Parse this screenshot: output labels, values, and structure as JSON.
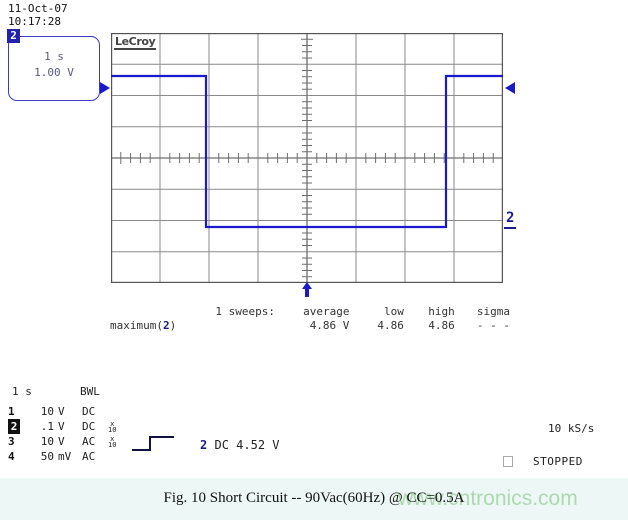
{
  "header": {
    "date": "11-Oct-07",
    "time": "10:17:28"
  },
  "channel_box": {
    "badge": "2",
    "timebase": "1 s",
    "volts_div": "1.00 V"
  },
  "scope": {
    "brand": "LeCroy",
    "ground_marker_label": "2",
    "grid_divisions_x": 8,
    "grid_divisions_y": 8
  },
  "measurements": {
    "headers": [
      "",
      "1 sweeps:",
      "average",
      "low",
      "high",
      "sigma"
    ],
    "rows": [
      {
        "name": "maximum(",
        "channel": "2",
        "name_end": ")",
        "average": "4.86 V",
        "low": "4.86",
        "high": "4.86",
        "sigma": "- - -"
      }
    ]
  },
  "settings": {
    "timebase": "1 s",
    "bandwidth_limit": "BWL",
    "channels": [
      {
        "num": "1",
        "value": "10",
        "unit": "V",
        "coupling": "DC",
        "atten": "",
        "selected": false
      },
      {
        "num": "2",
        "value": ".1",
        "unit": "V",
        "coupling": "DC",
        "atten": "x10",
        "selected": true
      },
      {
        "num": "3",
        "value": "10",
        "unit": "V",
        "coupling": "AC",
        "atten": "x10",
        "selected": false
      },
      {
        "num": "4",
        "value": "50",
        "unit": "mV",
        "coupling": "AC",
        "atten": "",
        "selected": false
      }
    ],
    "trigger": {
      "source": "2",
      "coupling": "DC",
      "level": "4.52 V",
      "slope": "rising"
    },
    "sample_rate": "10 kS/s",
    "acquisition_status": "STOPPED"
  },
  "caption": {
    "text": "Fig. 10  Short Circuit  --  90Vac(60Hz) @ CC=0.5A"
  },
  "watermark": {
    "text": "www.cntronics.com"
  },
  "chart_data": {
    "type": "line",
    "title": "Short Circuit -- 90Vac(60Hz) @ CC=0.5A",
    "xlabel": "Time (1 s/div)",
    "ylabel": "Voltage (1.00 V/div)",
    "xlim": [
      0,
      8
    ],
    "ylim": [
      0,
      8
    ],
    "grid": true,
    "legend": "none",
    "series": [
      {
        "name": "Channel 2",
        "color": "#1a1acc",
        "x": [
          0.0,
          1.95,
          1.95,
          6.85,
          6.85,
          8.0
        ],
        "y": [
          6.62,
          6.62,
          1.8,
          1.8,
          6.62,
          6.62
        ]
      }
    ],
    "annotations": [
      {
        "label": "ground-level-marker-ch2",
        "y": 1.8,
        "x": 8.0
      },
      {
        "label": "trigger-level-marker",
        "y": 6.62,
        "x": 0.0
      },
      {
        "label": "trigger-time-marker",
        "x": 4.0,
        "y": 0.0
      }
    ]
  }
}
